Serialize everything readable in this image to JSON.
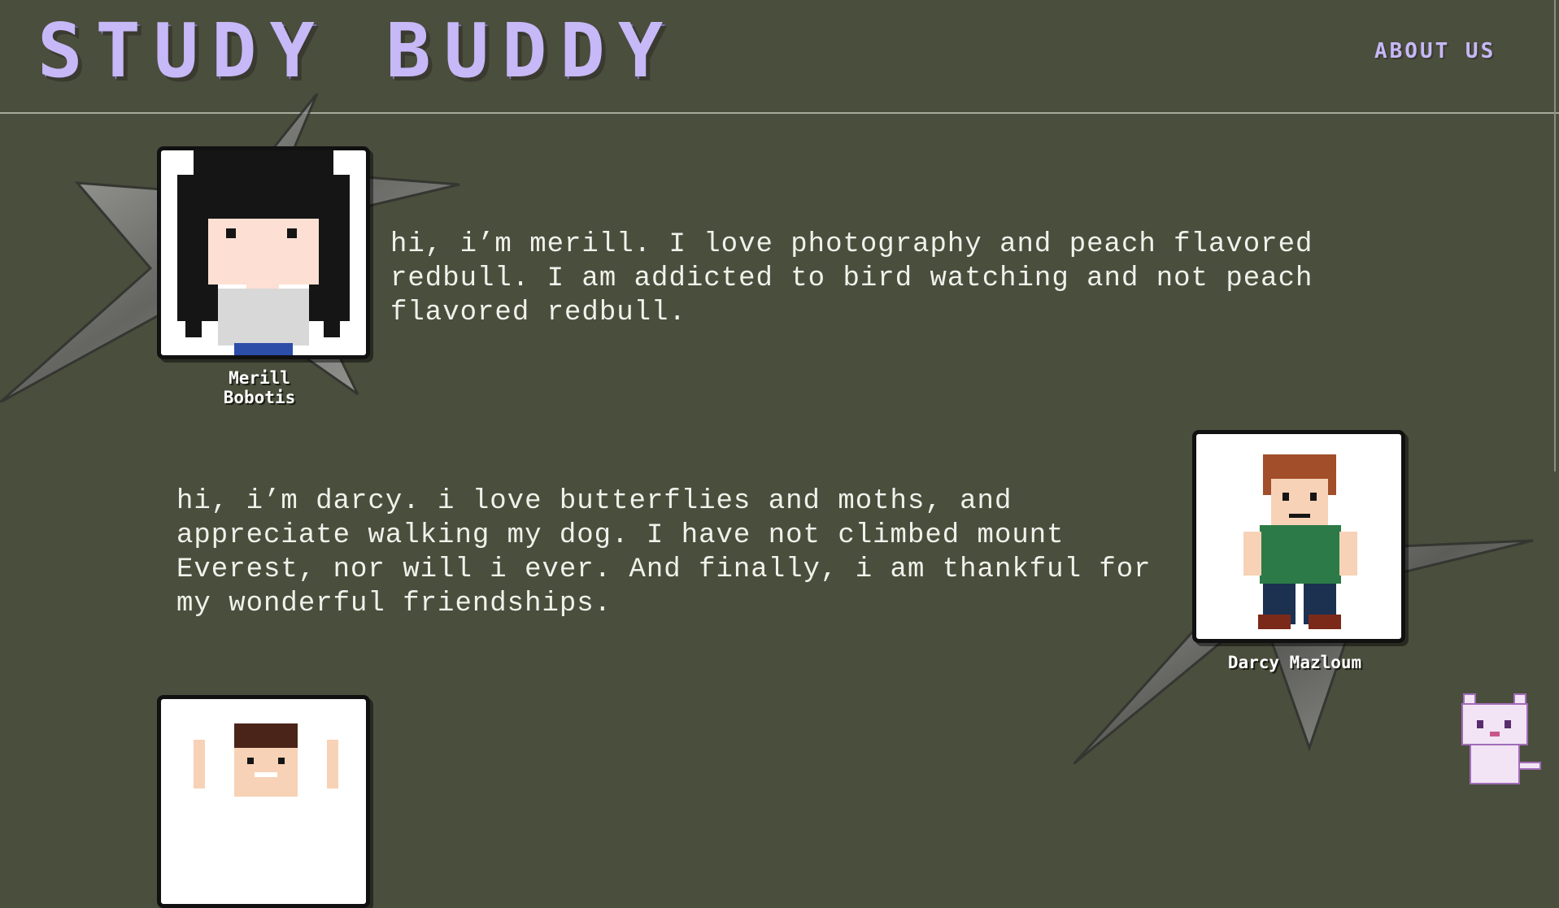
{
  "header": {
    "logo": "STUDY BUDDY",
    "nav_about": "ABOUT US"
  },
  "members": [
    {
      "name": "Merill Bobotis",
      "bio": "hi, i’m merill. I love photography and peach flavored redbull. I am addicted to bird watching and not peach flavored redbull."
    },
    {
      "name": "Darcy Mazloum",
      "bio": "hi, i’m darcy. i love butterflies and moths, and appreciate walking my dog. I have not climbed mount Everest, nor will i ever. And finally, i am thankful for my wonderful friendships."
    },
    {
      "name": "",
      "bio": ""
    }
  ],
  "colors": {
    "background": "#4a4e3c",
    "accent": "#c7b8f8",
    "text": "#f1f1ec"
  }
}
